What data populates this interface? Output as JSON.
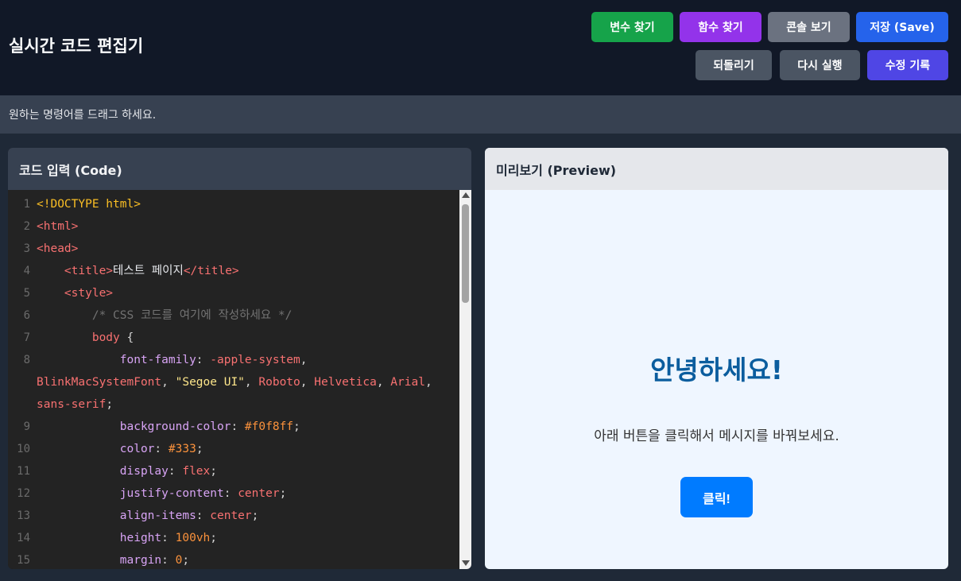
{
  "header": {
    "title": "실시간 코드 편집기",
    "buttons": {
      "find_variable": "변수 찾기",
      "find_function": "함수 찾기",
      "view_console": "콘솔 보기",
      "save": "저장 (Save)",
      "undo": "되돌리기",
      "redo": "다시 실행",
      "history": "수정 기록"
    }
  },
  "instruction": "원하는 명령어를 드래그 하세요.",
  "code_panel": {
    "title": "코드 입력 (Code)",
    "lines": [
      {
        "n": "1",
        "parts": [
          [
            "doc",
            "<!DOCTYPE html>"
          ]
        ]
      },
      {
        "n": "2",
        "parts": [
          [
            "tag",
            "<html>"
          ]
        ]
      },
      {
        "n": "3",
        "parts": [
          [
            "tag",
            "<head>"
          ]
        ]
      },
      {
        "n": "4",
        "parts": [
          [
            "plain",
            "    "
          ],
          [
            "tag",
            "<title>"
          ],
          [
            "text",
            "테스트 페이지"
          ],
          [
            "tag",
            "</title>"
          ]
        ]
      },
      {
        "n": "5",
        "parts": [
          [
            "plain",
            "    "
          ],
          [
            "tag",
            "<style>"
          ]
        ]
      },
      {
        "n": "6",
        "parts": [
          [
            "plain",
            "        "
          ],
          [
            "comment",
            "/* CSS 코드를 여기에 작성하세요 */"
          ]
        ]
      },
      {
        "n": "7",
        "parts": [
          [
            "plain",
            "        "
          ],
          [
            "selector",
            "body"
          ],
          [
            "punct",
            " {"
          ]
        ]
      },
      {
        "n": "8",
        "parts": [
          [
            "plain",
            "            "
          ],
          [
            "prop",
            "font-family"
          ],
          [
            "punct",
            ": "
          ],
          [
            "val",
            "-apple-system"
          ],
          [
            "punct",
            ","
          ]
        ]
      },
      {
        "n": "",
        "parts": [
          [
            "val",
            "BlinkMacSystemFont"
          ],
          [
            "punct",
            ", "
          ],
          [
            "str",
            "\"Segoe UI\""
          ],
          [
            "punct",
            ", "
          ],
          [
            "val",
            "Roboto"
          ],
          [
            "punct",
            ", "
          ],
          [
            "val",
            "Helvetica"
          ],
          [
            "punct",
            ", "
          ],
          [
            "val",
            "Arial"
          ],
          [
            "punct",
            ","
          ]
        ],
        "wrap": true
      },
      {
        "n": "",
        "parts": [
          [
            "val",
            "sans-serif"
          ],
          [
            "punct",
            ";"
          ]
        ],
        "wrap": true
      },
      {
        "n": "9",
        "parts": [
          [
            "plain",
            "            "
          ],
          [
            "prop",
            "background-color"
          ],
          [
            "punct",
            ": "
          ],
          [
            "num",
            "#f0f8ff"
          ],
          [
            "punct",
            ";"
          ]
        ]
      },
      {
        "n": "10",
        "parts": [
          [
            "plain",
            "            "
          ],
          [
            "prop",
            "color"
          ],
          [
            "punct",
            ": "
          ],
          [
            "num",
            "#333"
          ],
          [
            "punct",
            ";"
          ]
        ]
      },
      {
        "n": "11",
        "parts": [
          [
            "plain",
            "            "
          ],
          [
            "prop",
            "display"
          ],
          [
            "punct",
            ": "
          ],
          [
            "val",
            "flex"
          ],
          [
            "punct",
            ";"
          ]
        ]
      },
      {
        "n": "12",
        "parts": [
          [
            "plain",
            "            "
          ],
          [
            "prop",
            "justify-content"
          ],
          [
            "punct",
            ": "
          ],
          [
            "val",
            "center"
          ],
          [
            "punct",
            ";"
          ]
        ]
      },
      {
        "n": "13",
        "parts": [
          [
            "plain",
            "            "
          ],
          [
            "prop",
            "align-items"
          ],
          [
            "punct",
            ": "
          ],
          [
            "val",
            "center"
          ],
          [
            "punct",
            ";"
          ]
        ]
      },
      {
        "n": "14",
        "parts": [
          [
            "plain",
            "            "
          ],
          [
            "prop",
            "height"
          ],
          [
            "punct",
            ": "
          ],
          [
            "num",
            "100vh"
          ],
          [
            "punct",
            ";"
          ]
        ]
      },
      {
        "n": "15",
        "parts": [
          [
            "plain",
            "            "
          ],
          [
            "prop",
            "margin"
          ],
          [
            "punct",
            ": "
          ],
          [
            "num",
            "0"
          ],
          [
            "punct",
            ";"
          ]
        ]
      }
    ]
  },
  "preview_panel": {
    "title": "미리보기 (Preview)",
    "heading": "안녕하세요!",
    "message": "아래 버튼을 클릭해서 메시지를 바꿔보세요.",
    "button_label": "클릭!"
  },
  "colors": {
    "header_bg": "#111827",
    "preview_heading": "#0b5d9e",
    "preview_button": "#007bff"
  }
}
